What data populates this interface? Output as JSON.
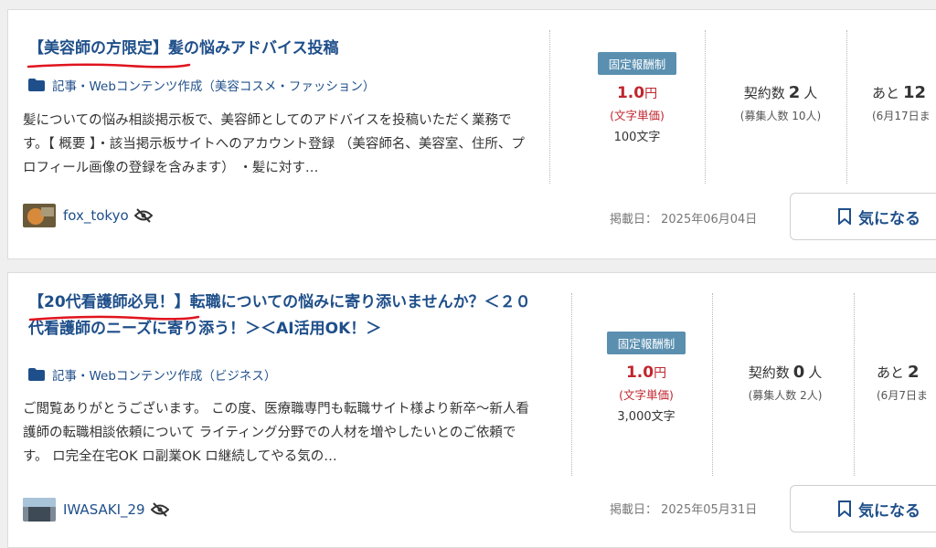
{
  "listings": [
    {
      "title": "【美容師の方限定】髪の悩みアドバイス投稿",
      "category": "記事・Webコンテンツ作成（美容コスメ・ファッション）",
      "description": "髪についての悩み相談掲示板で、美容師としてのアドバイスを投稿いただく業務です。【 概要 】・該当掲示板サイトへのアカウント登録 （美容師名、美容室、住所、プロフィール画像の登録を含みます） ・髪に対す…",
      "username": "fox_tokyo",
      "badge": "固定報酬制",
      "price": "1.0",
      "price_unit": "円",
      "price_type": "(文字単価)",
      "char_count": "100文字",
      "contract_label": "契約数",
      "contract_count": "2",
      "contract_unit": "人",
      "recruit": "(募集人数 10人)",
      "remaining_label": "あと",
      "remaining_num": "12",
      "deadline": "(6月17日ま",
      "posted": "掲載日： 2025年06月04日",
      "bookmark_label": "気になる"
    },
    {
      "title": "【20代看護師必見！】転職についての悩みに寄り添いませんか？＜２０代看護師のニーズに寄り添う！＞＜AI活用OK！＞",
      "category": "記事・Webコンテンツ作成（ビジネス）",
      "description": "ご閲覧ありがとうございます。 この度、医療職専門も転職サイト様より新卒～新人看護師の転職相談依頼について ライティング分野での人材を増やしたいとのご依頼です。 ロ完全在宅OK ロ副業OK ロ継続してやる気の…",
      "username": "IWASAKI_29",
      "badge": "固定報酬制",
      "price": "1.0",
      "price_unit": "円",
      "price_type": "(文字単価)",
      "char_count": "3,000文字",
      "contract_label": "契約数",
      "contract_count": "0",
      "contract_unit": "人",
      "recruit": "(募集人数 2人)",
      "remaining_label": "あと",
      "remaining_num": "2",
      "deadline": "(6月7日ま",
      "posted": "掲載日： 2025年05月31日",
      "bookmark_label": "気になる"
    }
  ],
  "icons": {
    "category": "folder-icon",
    "hidden": "eye-off-icon",
    "bookmark": "bookmark-icon"
  },
  "colors": {
    "link": "#1f4f8a",
    "price": "#c0262e",
    "badge": "#5a8fb0",
    "highlight": "#e0141e"
  }
}
